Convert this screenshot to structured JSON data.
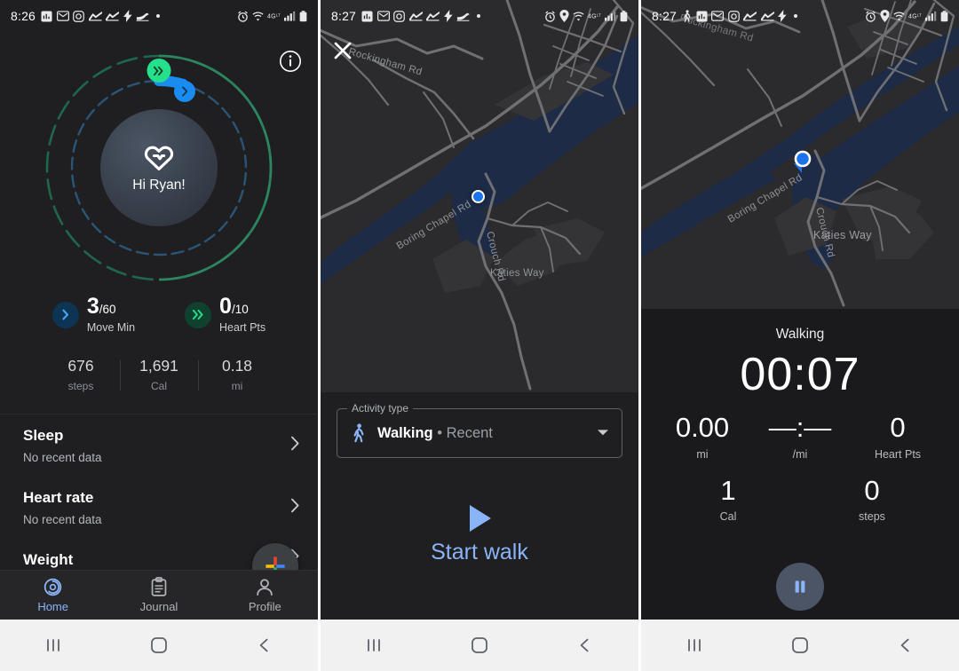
{
  "screen1": {
    "statusbar": {
      "time": "8:26",
      "icons": [
        "inv-icon",
        "gmail-icon",
        "instagram-icon",
        "chart-icon",
        "chart-icon",
        "flash-icon",
        "shoe-icon",
        "dot-icon"
      ],
      "right_icons": [
        "alarm-icon",
        "wifi-icon",
        "4g-icon",
        "signal-icon",
        "battery-icon"
      ]
    },
    "info_icon": "info-icon",
    "greeting": "Hi Ryan!",
    "heart_icon": "google-fit-heart-icon",
    "goals": [
      {
        "icon": "move-min-chevron-icon",
        "value": "3",
        "target": "/60",
        "label": "Move Min",
        "color": "#1a73e8"
      },
      {
        "icon": "heart-pts-chevrons-icon",
        "value": "0",
        "target": "/10",
        "label": "Heart Pts",
        "color": "#24c77f"
      }
    ],
    "mini_stats": [
      {
        "value": "676",
        "label": "steps"
      },
      {
        "value": "1,691",
        "label": "Cal"
      },
      {
        "value": "0.18",
        "label": "mi"
      }
    ],
    "list": [
      {
        "title": "Sleep",
        "subtitle": "No recent data"
      },
      {
        "title": "Heart rate",
        "subtitle": "No recent data"
      },
      {
        "title": "Weight",
        "subtitle": ""
      }
    ],
    "fab_icon": "google-plus-add-icon",
    "nav": [
      {
        "icon": "home-rings-icon",
        "label": "Home",
        "active": true
      },
      {
        "icon": "journal-clipboard-icon",
        "label": "Journal",
        "active": false
      },
      {
        "icon": "profile-person-icon",
        "label": "Profile",
        "active": false
      }
    ],
    "system_nav": [
      "recents-button",
      "home-button",
      "back-button"
    ]
  },
  "screen2": {
    "statusbar": {
      "time": "8:27",
      "icons": [
        "inv-icon",
        "gmail-icon",
        "instagram-icon",
        "chart-icon",
        "chart-icon",
        "flash-icon",
        "shoe-icon",
        "dot-icon"
      ],
      "right_icons": [
        "alarm-icon",
        "location-icon",
        "wifi-icon",
        "4g-icon",
        "signal-icon",
        "battery-icon"
      ]
    },
    "close_icon": "close-icon",
    "map": {
      "labels": [
        "Rockingham Rd",
        "Boring Chapel Rd",
        "Crouch Rd",
        "Katies Way"
      ],
      "marker": "current-location-dot",
      "water_color": "#1d2b47",
      "land_color": "#2b2b2d",
      "road_color": "#6e7073"
    },
    "activity_field": {
      "legend": "Activity type",
      "icon": "walking-person-icon",
      "value": "Walking",
      "suffix": "• Recent",
      "caret": "chevron-down-icon"
    },
    "start": {
      "icon": "play-icon",
      "label": "Start walk"
    },
    "system_nav": [
      "recents-button",
      "home-button",
      "back-button"
    ]
  },
  "screen3": {
    "statusbar": {
      "time": "8:27",
      "icons": [
        "walking-person-icon",
        "inv-icon",
        "gmail-icon",
        "instagram-icon",
        "chart-icon",
        "chart-icon",
        "flash-icon",
        "dot-icon"
      ],
      "right_icons": [
        "alarm-icon",
        "location-icon",
        "wifi-icon",
        "4g-icon",
        "signal-icon",
        "battery-icon"
      ]
    },
    "map": {
      "labels": [
        "Rockingham Rd",
        "Boring Chapel Rd",
        "Crouch Rd",
        "Katies Way"
      ],
      "marker": "current-location-pin",
      "water_color": "#1d2b47",
      "land_color": "#2b2b2d",
      "road_color": "#6e7073"
    },
    "tracking": {
      "title": "Walking",
      "timer": "00:07",
      "row1": [
        {
          "value": "0.00",
          "label": "mi"
        },
        {
          "value": "—:—",
          "label": "/mi"
        },
        {
          "value": "0",
          "label": "Heart Pts"
        }
      ],
      "row2": [
        {
          "value": "1",
          "label": "Cal"
        },
        {
          "value": "0",
          "label": "steps"
        }
      ],
      "pause_icon": "pause-icon"
    },
    "system_nav": [
      "recents-button",
      "home-button",
      "back-button"
    ]
  }
}
